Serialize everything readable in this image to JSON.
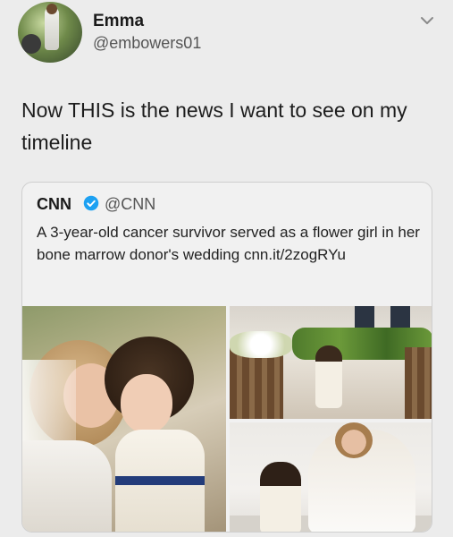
{
  "tweet": {
    "author_name": "Emma",
    "author_handle": "@embowers01",
    "text": "Now THIS is the news I want to see on my timeline"
  },
  "quoted_tweet": {
    "author_name": "CNN",
    "author_handle": "@CNN",
    "verified": true,
    "text": "A 3-year-old cancer survivor served as a flower girl in her bone marrow donor's wedding ",
    "link": "cnn.it/2zogRYu"
  },
  "icons": {
    "menu": "chevron-down-icon",
    "verified": "verified-badge-icon"
  },
  "colors": {
    "verified_blue": "#1da1f2",
    "sash_navy": "#233c7a"
  }
}
